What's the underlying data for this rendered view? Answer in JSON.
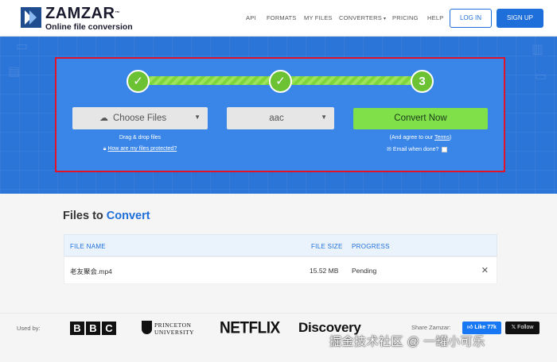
{
  "header": {
    "brand": "ZAMZAR",
    "brand_tm": "™",
    "tagline": "Online file conversion",
    "nav": [
      "API",
      "FORMATS",
      "MY FILES",
      "CONVERTERS",
      "PRICING",
      "HELP"
    ],
    "nav_caret": "▾",
    "login": "LOG IN",
    "signup": "SIGN UP"
  },
  "converter": {
    "step1": "✓",
    "step2": "✓",
    "step3": "3",
    "choose_files": "Choose Files",
    "drag_drop": "Drag & drop files",
    "protected_link": "How are my files protected?",
    "format_value": "aac",
    "convert_button": "Convert Now",
    "agree_prefix": "(And agree to our ",
    "terms": "Terms",
    "agree_suffix": ")",
    "email_when_done": "Email when done?"
  },
  "files": {
    "title_prefix": "Files to ",
    "title_accent": "Convert",
    "columns": {
      "name": "FILE NAME",
      "size": "FILE SIZE",
      "progress": "PROGRESS"
    },
    "rows": [
      {
        "name": "老友聚会.mp4",
        "size": "15.52 MB",
        "progress": "Pending"
      }
    ],
    "remove": "✕"
  },
  "footer": {
    "used_by": "Used by:",
    "bbc": [
      "B",
      "B",
      "C"
    ],
    "princeton_line1": "PRINCETON",
    "princeton_line2": "UNIVERSITY",
    "netflix": "NETFLIX",
    "discovery": "Discovery",
    "share": "Share Zamzar:",
    "like": "Like 77k",
    "follow": "Follow"
  },
  "watermark": "掘金技术社区 @ 一罐小可乐",
  "colors": {
    "brand_blue": "#1e6fd9",
    "hero_blue": "#2b74d8",
    "step_green": "#6cc233",
    "convert_green": "#7fe049",
    "highlight_red": "#e0132a"
  }
}
